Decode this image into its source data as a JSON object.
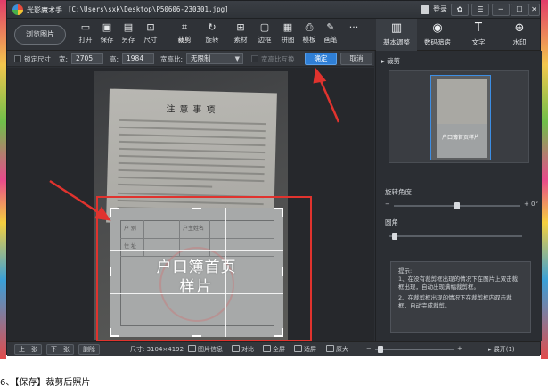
{
  "window": {
    "app_name": "光影魔术手",
    "file_path": "[C:\\Users\\sxk\\Desktop\\P50606-230301.jpg]",
    "login_label": "登录",
    "controls": [
      "✿",
      "☰",
      "─",
      "☐",
      "✕"
    ]
  },
  "toolbar": {
    "browse_label": "浏览图片",
    "tools": [
      {
        "label": "打开",
        "icon": "open-icon",
        "glyph": "▭"
      },
      {
        "label": "保存",
        "icon": "save-icon",
        "glyph": "▣"
      },
      {
        "label": "另存",
        "icon": "save-as-icon",
        "glyph": "▤"
      },
      {
        "label": "尺寸",
        "icon": "resize-icon",
        "glyph": "⊡"
      },
      {
        "label": "裁剪",
        "icon": "crop-icon",
        "glyph": "⌗"
      },
      {
        "label": "旋转",
        "icon": "rotate-icon",
        "glyph": "↻"
      },
      {
        "label": "素材",
        "icon": "material-icon",
        "glyph": "⊞"
      },
      {
        "label": "边框",
        "icon": "border-icon",
        "glyph": "▢"
      },
      {
        "label": "拼图",
        "icon": "collage-icon",
        "glyph": "▦"
      },
      {
        "label": "模板",
        "icon": "template-icon",
        "glyph": "⎙"
      },
      {
        "label": "画笔",
        "icon": "brush-icon",
        "glyph": "✎"
      },
      {
        "label": "",
        "icon": "more-icon",
        "glyph": "···"
      }
    ],
    "right_tabs": [
      {
        "label": "基本调整",
        "icon": "adjust-icon",
        "glyph": "▥"
      },
      {
        "label": "数码暗房",
        "icon": "camera-icon",
        "glyph": "◉"
      },
      {
        "label": "文字",
        "icon": "text-icon",
        "glyph": "T"
      },
      {
        "label": "水印",
        "icon": "watermark-icon",
        "glyph": "⊕"
      }
    ]
  },
  "crop_options": {
    "lock_size_label": "锁定尺寸",
    "width_label": "宽:",
    "width_value": "2705",
    "height_label": "高:",
    "height_value": "1984",
    "ratio_label": "宽高比:",
    "ratio_value": "无限制",
    "ratio_hint": "宽高比互换",
    "ok_label": "确定",
    "cancel_label": "取消"
  },
  "canvas": {
    "notice_title": "注意事项",
    "sample_title": "户口簿首页",
    "sample_subtitle": "样片",
    "cell_labels": [
      "户  别",
      "户主姓名",
      "住  址"
    ]
  },
  "status": {
    "prev_label": "上一张",
    "next_label": "下一张",
    "delete_label": "删除",
    "size_text": "尺寸: 3104×4192",
    "info_label": "图片信息",
    "compare_label": "对比",
    "fullscreen_label": "全屏",
    "fit_label": "适屏",
    "original_label": "原大",
    "zoom_minus": "−",
    "zoom_plus": "+",
    "zoom_level": 0.04,
    "expand_label": "展开(1)"
  },
  "right_panel": {
    "section_title": "裁剪",
    "thumb_caption": "户口簿首页样片",
    "rotate_label": "旋转角度",
    "rotate_value": "0°",
    "rotate_min": "−",
    "rotate_plus": "+",
    "rotate_level": 0.5,
    "corner_label": "圆角",
    "corner_level": 0.03,
    "tips_title": "提示:",
    "tip_1": "1、在没有裁剪框出现的情况下在图片上双击裁框出现，自动出现满幅裁剪框。",
    "tip_2": "2、在裁剪框出现的情况下在裁剪框内双击裁框，自动完成裁剪。"
  },
  "caption": "6、【保存】裁剪后照片",
  "annotation": {
    "box_color": "#e0332e",
    "accent_color": "#2f7fd6"
  }
}
